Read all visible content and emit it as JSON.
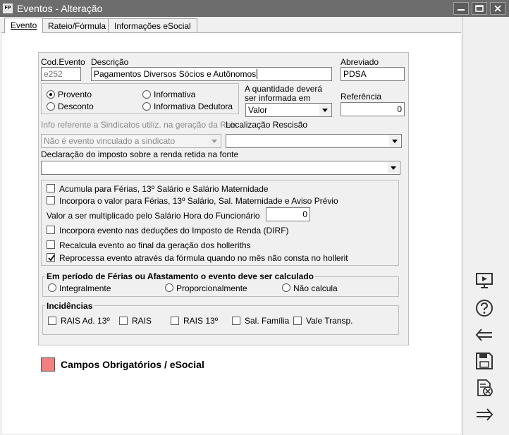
{
  "window": {
    "app_icon_text": "FP",
    "title": "Eventos - Alteração"
  },
  "tabs": [
    {
      "label": "Evento",
      "active": true
    },
    {
      "label": "Rateio/Fórmula",
      "active": false
    },
    {
      "label": "Informações eSocial",
      "active": false
    }
  ],
  "form": {
    "cod_evento": {
      "label": "Cod.Evento",
      "value": "e252"
    },
    "descricao": {
      "label": "Descrição",
      "value": "Pagamentos Diversos Sócios e Autônomos"
    },
    "abreviado": {
      "label": "Abreviado",
      "value": "PDSA"
    },
    "tipo": {
      "options": [
        "Provento",
        "Desconto",
        "Informativa",
        "Informativa Dedutora"
      ],
      "selected": "Provento"
    },
    "quantidade": {
      "label_line1": "A quantidade deverá",
      "label_line2": "ser informada em",
      "value": "Valor"
    },
    "referencia": {
      "label": "Referência",
      "value": "0"
    },
    "sindicato": {
      "label": "Info referente a Sindicatos utiliz. na geração da Rais",
      "value": "Não é evento vinculado a sindicato"
    },
    "localizacao": {
      "label": "Localização Rescisão",
      "value": ""
    },
    "declaracao": {
      "label": "Declaração do imposto sobre a renda retida na fonte",
      "value": ""
    },
    "options": {
      "acumula": {
        "label": "Acumula para Férias, 13º Salário e Salário Maternidade",
        "checked": false
      },
      "incorpora_valor": {
        "label": "Incorpora o valor para Férias, 13º Salário, Sal. Maternidade e Aviso Prévio",
        "checked": false
      },
      "multiplicador": {
        "label": "Valor a ser multiplicado pelo Salário Hora do Funcionário",
        "value": "0"
      },
      "dirf": {
        "label": "Incorpora evento nas deduções do Imposto de Renda (DIRF)",
        "checked": false
      },
      "recalcula": {
        "label": "Recalcula evento ao final da geração dos holleriths",
        "checked": false
      },
      "reprocessa": {
        "label": "Reprocessa evento através da fórmula quando no mês não consta no hollerit",
        "checked": true
      }
    },
    "periodo": {
      "legend": "Em período de Férias ou Afastamento o evento deve ser calculado",
      "options": [
        "Integralmente",
        "Proporcionalmente",
        "Não calcula"
      ],
      "selected": ""
    },
    "incidencias": {
      "legend": "Incidências",
      "items": [
        {
          "label": "RAIS Ad. 13º",
          "checked": false
        },
        {
          "label": "RAIS",
          "checked": false
        },
        {
          "label": "RAIS 13º",
          "checked": false
        },
        {
          "label": "Sal. Família",
          "checked": false
        },
        {
          "label": "Vale Transp.",
          "checked": false
        }
      ]
    }
  },
  "legend_required": {
    "text": "Campos Obrigatórios / eSocial",
    "color": "#f47f80"
  },
  "sidebar_icons": [
    "monitor-icon",
    "help-icon",
    "back-arrow-icon",
    "save-icon",
    "cancel-document-icon",
    "forward-arrow-icon"
  ]
}
